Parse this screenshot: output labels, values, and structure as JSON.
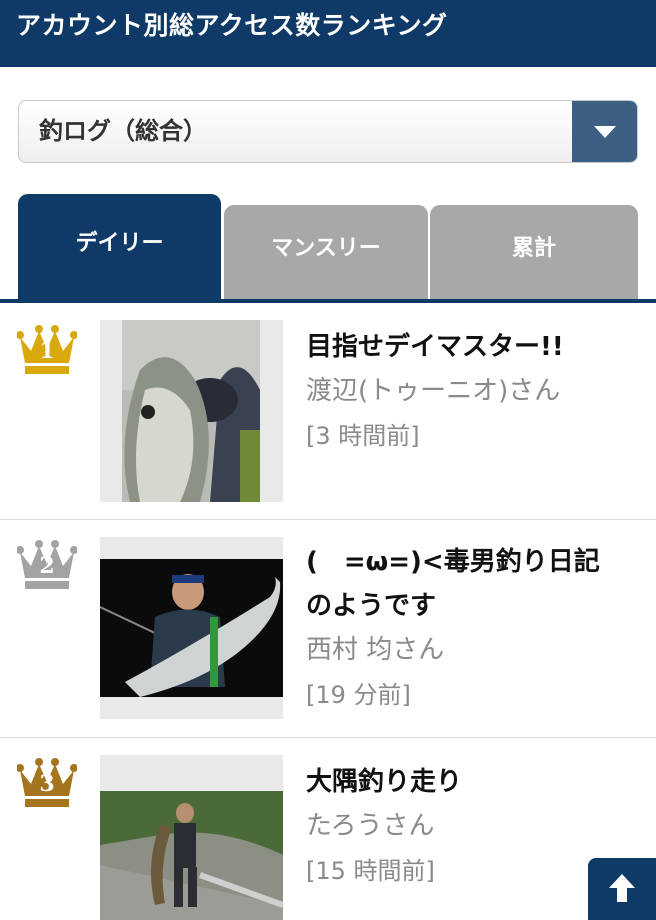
{
  "header": {
    "title": "アカウント別総アクセス数ランキング"
  },
  "category_select": {
    "selected": "釣ログ（総合）"
  },
  "tabs": [
    {
      "label": "デイリー",
      "active": true
    },
    {
      "label": "マンスリー",
      "active": false
    },
    {
      "label": "累計",
      "active": false
    }
  ],
  "rankings": [
    {
      "rank": "1",
      "crown_color": "#d9a80d",
      "title": "目指せデイマスター!!",
      "author": "渡辺(トゥーニオ)さん",
      "time": "[3 時間前]"
    },
    {
      "rank": "2",
      "crown_color": "#a3a3a3",
      "title_line1": "(　=ω=)<毒男釣り日記",
      "title_line2": "のようです",
      "author": "西村 均さん",
      "time": "[19 分前]"
    },
    {
      "rank": "3",
      "crown_color": "#a4741e",
      "title": "大隅釣り走り",
      "author": "たろうさん",
      "time": "[15 時間前]"
    }
  ],
  "icons": {
    "select_arrow": "chevron-down-icon",
    "back_to_top": "arrow-up-icon"
  }
}
